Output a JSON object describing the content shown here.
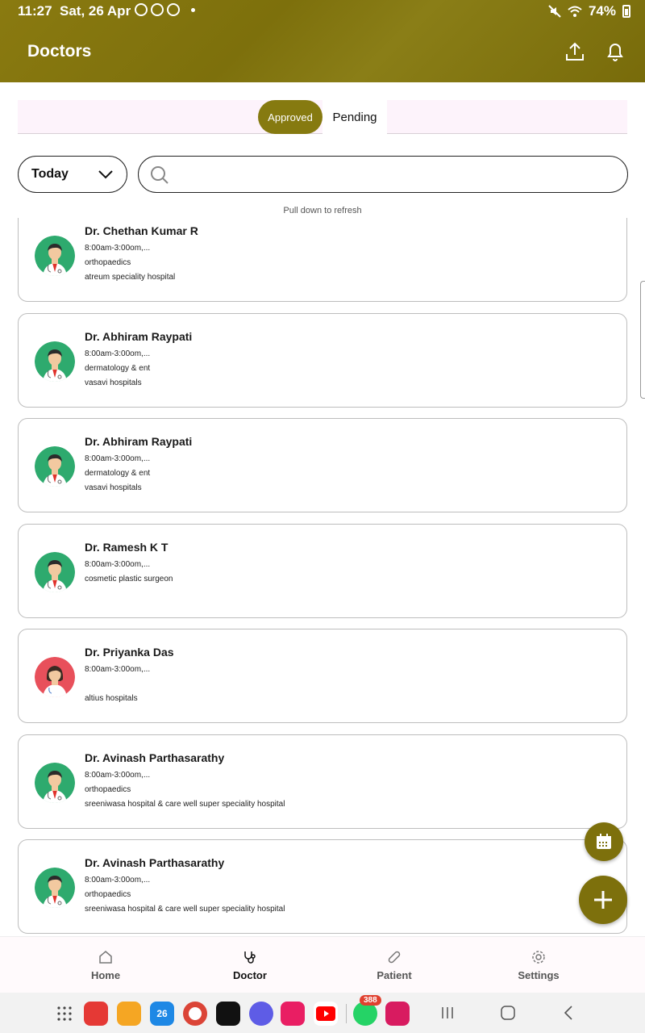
{
  "status": {
    "time": "11:27",
    "date": "Sat, 26 Apr",
    "battery": "74%"
  },
  "header": {
    "title": "Doctors",
    "background": "#867a10"
  },
  "tabs": [
    {
      "label": "Approved",
      "active": true
    },
    {
      "label": "Pending",
      "active": false
    }
  ],
  "filter": {
    "selected": "Today",
    "search_placeholder": ""
  },
  "refresh_hint": "Pull down to refresh",
  "doctors": [
    {
      "name": "Dr. Chethan Kumar R",
      "time": "8:00am-3:00om,...",
      "specialty": "orthopaedics",
      "hospital": "atreum speciality hospital",
      "avatar": "male"
    },
    {
      "name": "Dr. Abhiram Raypati",
      "time": "8:00am-3:00om,...",
      "specialty": "dermatology & ent",
      "hospital": "vasavi hospitals",
      "avatar": "male"
    },
    {
      "name": "Dr. Abhiram Raypati",
      "time": "8:00am-3:00om,...",
      "specialty": "dermatology & ent",
      "hospital": "vasavi hospitals",
      "avatar": "male"
    },
    {
      "name": "Dr. Ramesh K T",
      "time": "8:00am-3:00om,...",
      "specialty": "cosmetic plastic surgeon",
      "hospital": "",
      "avatar": "male"
    },
    {
      "name": "Dr. Priyanka Das",
      "time": "8:00am-3:00om,...",
      "specialty": "",
      "hospital": "altius hospitals",
      "avatar": "female"
    },
    {
      "name": "Dr. Avinash Parthasarathy",
      "time": "8:00am-3:00om,...",
      "specialty": "orthopaedics",
      "hospital": "sreeniwasa hospital & care well super speciality hospital",
      "avatar": "male"
    },
    {
      "name": "Dr. Avinash Parthasarathy",
      "time": "8:00am-3:00om,...",
      "specialty": "orthopaedics",
      "hospital": "sreeniwasa hospital & care well super speciality hospital",
      "avatar": "male"
    }
  ],
  "bottom_nav": [
    {
      "label": "Home",
      "icon": "home-icon",
      "active": false
    },
    {
      "label": "Doctor",
      "icon": "stethoscope-icon",
      "active": true
    },
    {
      "label": "Patient",
      "icon": "bandage-icon",
      "active": false
    },
    {
      "label": "Settings",
      "icon": "gear-icon",
      "active": false
    }
  ],
  "dock": {
    "calendar_day": "26",
    "whatsapp_badge": "388"
  },
  "colors": {
    "accent": "#867a10",
    "male_avatar_bg": "#2eaa6e",
    "female_avatar_bg": "#e8505b"
  }
}
